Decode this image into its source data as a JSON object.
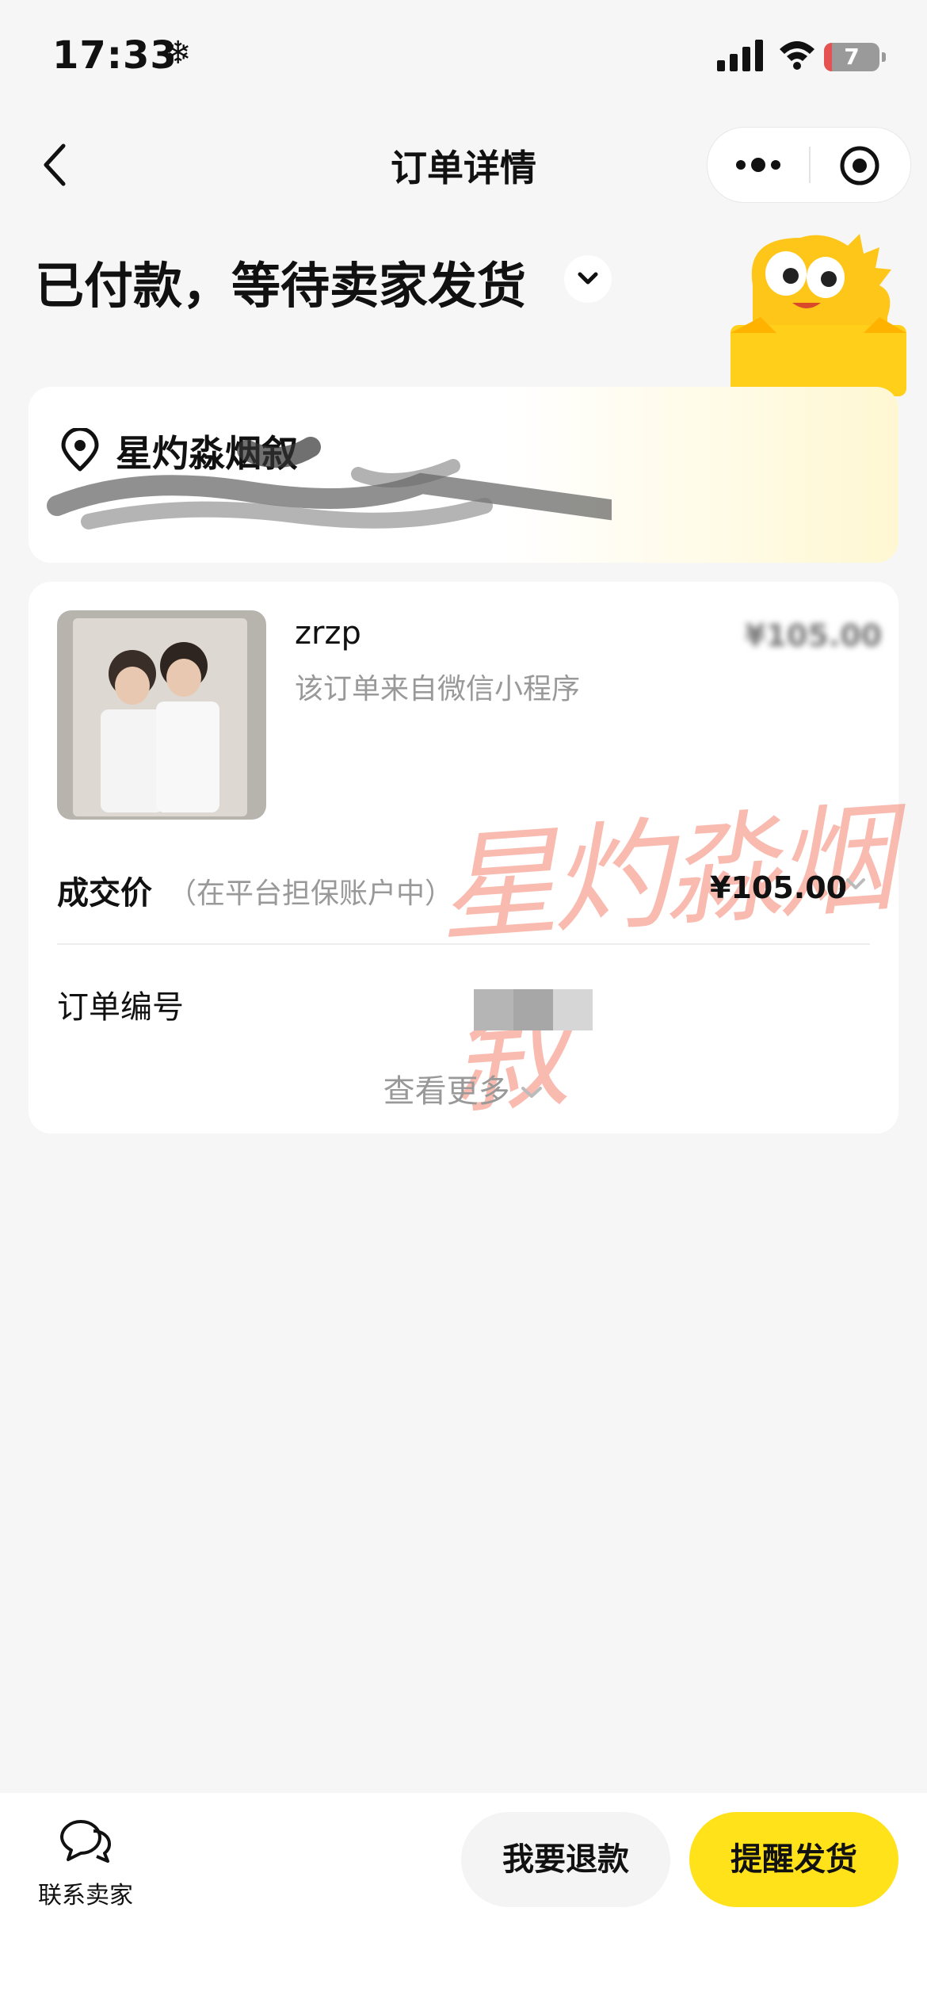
{
  "status_bar": {
    "time": "17:33",
    "battery_level": "7"
  },
  "nav": {
    "title": "订单详情"
  },
  "order_status": {
    "title": "已付款，等待卖家发货"
  },
  "address": {
    "name": "星灼淼烟叙"
  },
  "product": {
    "name": "zrzp",
    "source": "该订单来自微信小程序",
    "price": "¥105.00"
  },
  "deal": {
    "label": "成交价",
    "note": "（在平台担保账户中）",
    "price": "¥105.00"
  },
  "order_number": {
    "label": "订单编号"
  },
  "more": {
    "label": "查看更多"
  },
  "watermark": {
    "text": "星灼淼烟叙"
  },
  "bottom": {
    "contact_label": "联系卖家",
    "refund_label": "我要退款",
    "remind_label": "提醒发货"
  },
  "colors": {
    "accent": "#ffe21a",
    "background": "#f6f6f6"
  }
}
